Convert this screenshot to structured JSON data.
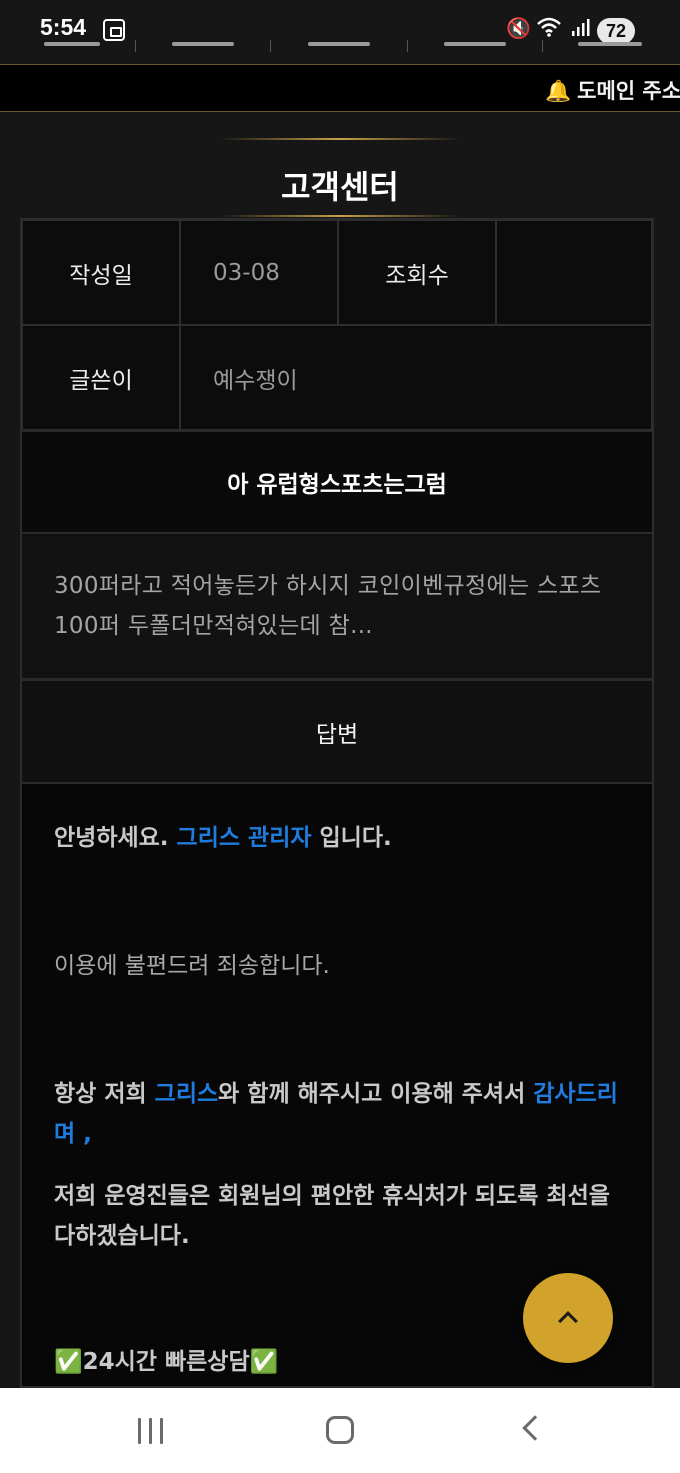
{
  "status_bar": {
    "time": "5:54",
    "battery": "72",
    "icons": [
      "screenshot-icon",
      "mute-icon",
      "wifi-icon",
      "signal-icon",
      "battery-icon"
    ]
  },
  "ticker": {
    "icon": "bell-icon",
    "text": "도메인 주소"
  },
  "page": {
    "title": "고객센터"
  },
  "post": {
    "date_label": "작성일",
    "date_value": "03-08",
    "views_label": "조회수",
    "views_value": "",
    "author_label": "글쓴이",
    "author_value": "예수쟁이",
    "subject": "아 유럽형스포츠는그럼",
    "content": "300퍼라고 적어놓든가 하시지 코인이벤규정에는 스포츠100퍼 두폴더만적혀있는데 참..."
  },
  "answer": {
    "header": "답변",
    "greeting_pre": "안녕하세요. ",
    "greeting_highlight": "그리스 관리자",
    "greeting_post": " 입니다.",
    "apology": "이용에 불편드려 죄송합니다.",
    "thanks_pre": "항상 저희 ",
    "thanks_brand": "그리스",
    "thanks_mid": "와 함께 해주시고 이용해 주셔서 ",
    "thanks_highlight": "감사드리며 ,",
    "promise": "저희 운영진들은 회원님의 편안한 휴식처가 되도록 최선을 다하겠습니다.",
    "check_mark": "✅",
    "support_text": "24시간 빠른상담"
  },
  "colors": {
    "accent_gold": "#d1a32a",
    "link_blue": "#1f7de0",
    "background": "#161616"
  },
  "scroll_top": {
    "icon": "chevron-up-icon"
  },
  "nav_bar": {
    "icons": [
      "recents-icon",
      "home-icon",
      "back-icon"
    ]
  }
}
